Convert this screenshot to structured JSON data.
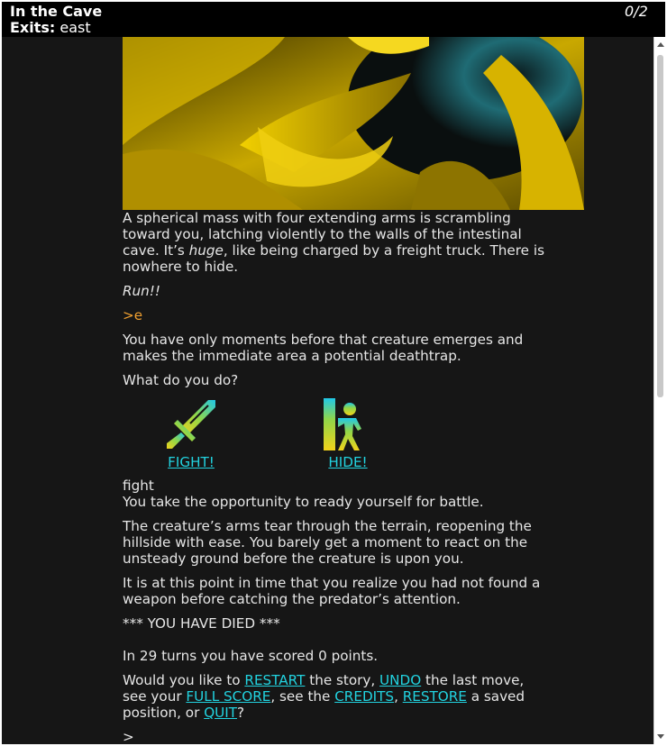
{
  "status": {
    "location": "In the Cave",
    "exits_label": "Exits:",
    "exits_value": "east",
    "score": "0/2"
  },
  "story": {
    "intro_p1_a": "A spherical mass with four extending arms is scrambling toward you, latching violently to the walls of the intestinal cave.  It’s ",
    "intro_p1_em": "huge",
    "intro_p1_b": ", like being charged by a freight truck.  There is nowhere to hide.",
    "run": "Run!!",
    "command_echo": ">e",
    "moments": "You have only moments before that creature emerges and makes the immediate area a potential deathtrap.",
    "question": "What do you do?",
    "choice_fight": "FIGHT!",
    "choice_hide": "HIDE!",
    "chosen": "fight",
    "ready": "You take the opportunity to ready yourself for battle.",
    "arms": "The creature’s arms tear through the terrain, reopening the hillside with ease.  You barely get a moment to react on the unsteady ground before the creature is upon you.",
    "realize": "It is at this point in time that you realize you had not found a weapon before catching the predator’s attention.",
    "died": "*** YOU HAVE DIED ***",
    "turns": "In 29 turns you have scored 0 points.",
    "end_a": "Would you like to ",
    "link_restart": "RESTART",
    "end_b": " the story, ",
    "link_undo": "UNDO",
    "end_c": " the last move, see your ",
    "link_fullscore": "FULL SCORE",
    "end_d": ", see the ",
    "link_credits": "CREDITS",
    "end_e": ", ",
    "link_restore": "RESTORE",
    "end_f": " a saved position, or ",
    "link_quit": "QUIT",
    "end_g": "?",
    "input_prompt": ">"
  },
  "icons": {
    "fight": "sword-icon",
    "hide": "hiding-figure-icon"
  },
  "colors": {
    "background": "#161616",
    "text": "#e6e6e6",
    "link": "#22d3e0",
    "command": "#f0a030",
    "status_bar": "#000000"
  }
}
